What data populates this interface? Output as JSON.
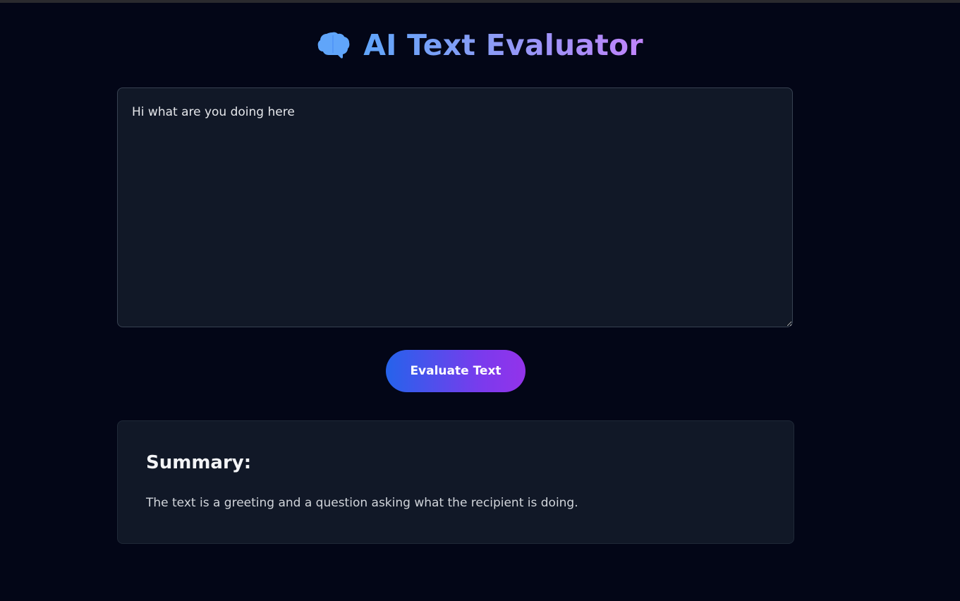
{
  "header": {
    "title": "AI Text Evaluator",
    "icon": "brain-icon"
  },
  "input": {
    "value": "Hi what are you doing here"
  },
  "actions": {
    "evaluate_label": "Evaluate Text"
  },
  "summary": {
    "heading": "Summary:",
    "text": "The text is a greeting and a question asking what the recipient is doing."
  },
  "colors": {
    "background": "#030617",
    "panel": "#111827",
    "accent_start": "#2563eb",
    "accent_end": "#9333ea",
    "icon": "#60a5fa"
  }
}
